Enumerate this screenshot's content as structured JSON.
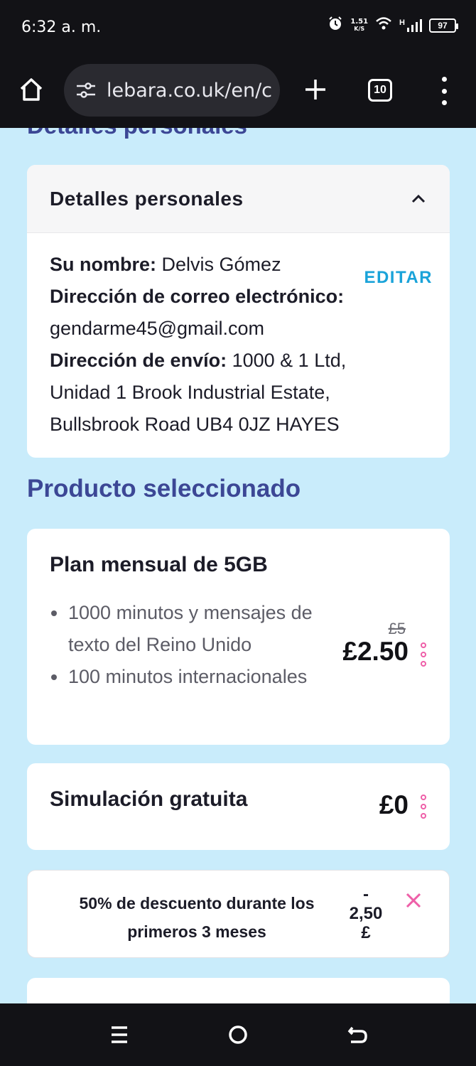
{
  "status_bar": {
    "time": "6:32 a. m.",
    "speed_value": "1.51",
    "speed_unit": "K/S",
    "network_type": "H",
    "battery": "97",
    "icons": [
      "alarm-icon",
      "wifi-icon",
      "signal-icon",
      "battery-icon"
    ]
  },
  "browser": {
    "url": "lebara.co.uk/en/c",
    "tab_count": "10",
    "icons": [
      "home-icon",
      "site-settings-icon",
      "new-tab-icon",
      "tabs-icon",
      "more-menu-icon"
    ]
  },
  "page": {
    "cut_heading": "Detalles personales",
    "details": {
      "title": "Detalles personales",
      "edit_label": "EDITAR",
      "name_label": "Su nombre:",
      "name_value": "Delvis Gómez",
      "email_label": "Dirección de correo electrónico:",
      "email_value": "gendarme45@gmail.com",
      "address_label": "Dirección de envío:",
      "address_line1": "1000 & 1 Ltd,",
      "address_line2": "Unidad 1 Brook Industrial Estate,",
      "address_line3": "Bullsbrook Road UB4 0JZ HAYES"
    },
    "section_title": "Producto seleccionado",
    "plan": {
      "title": "Plan mensual de 5GB",
      "features": [
        "1000 minutos y mensajes de texto del Reino Unido",
        "100 minutos internacionales"
      ],
      "old_price": "£5",
      "price": "£2.50"
    },
    "sim": {
      "title": "Simulación gratuita",
      "price": "£0"
    },
    "promo": {
      "text": "50% de descuento durante los primeros 3 meses",
      "amount_sign": "-",
      "amount_value": "2,50",
      "amount_currency": "£"
    }
  },
  "colors": {
    "page_background": "#c9ecfb",
    "heading": "#3c4795",
    "edit_link": "#1aa3d9",
    "accent_pink": "#ee5fa8",
    "system_bar": "#121216"
  }
}
